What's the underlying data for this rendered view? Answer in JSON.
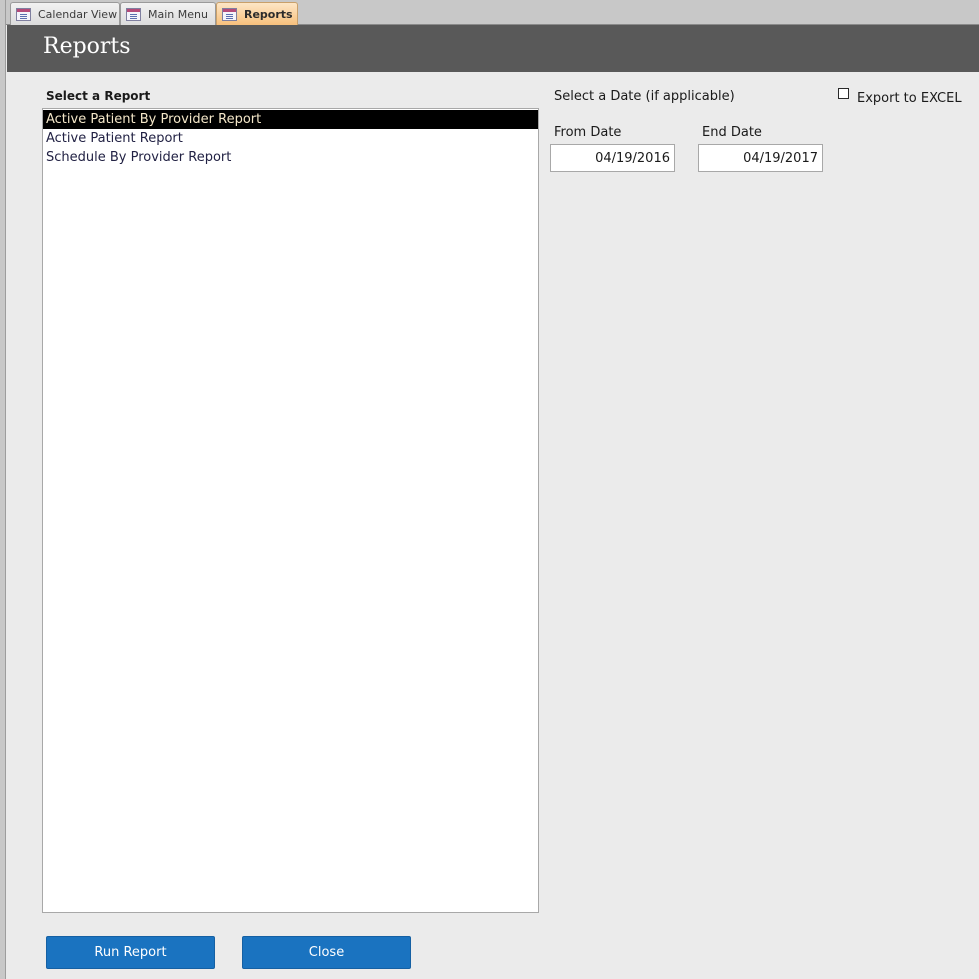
{
  "tabs": [
    {
      "label": "Calendar View",
      "icon": "form-icon",
      "active": false
    },
    {
      "label": "Main Menu",
      "icon": "form-icon",
      "active": false
    },
    {
      "label": "Reports",
      "icon": "form-icon",
      "active": true
    }
  ],
  "header": {
    "title": "Reports"
  },
  "report_list": {
    "label": "Select a Report",
    "items": [
      {
        "label": "Active Patient By Provider Report",
        "selected": true
      },
      {
        "label": "Active Patient Report",
        "selected": false
      },
      {
        "label": "Schedule By Provider Report",
        "selected": false
      }
    ]
  },
  "date_section": {
    "label": "Select a Date (if applicable)",
    "from_label": "From Date",
    "from_value": "04/19/2016",
    "end_label": "End Date",
    "end_value": "04/19/2017"
  },
  "export": {
    "label": "Export to EXCEL",
    "checked": false
  },
  "buttons": {
    "run": "Run Report",
    "close": "Close"
  },
  "colors": {
    "header_bg": "#595959",
    "button_bg": "#1a73c0",
    "active_tab": "#f7c07c",
    "selected_row": "#000000"
  }
}
